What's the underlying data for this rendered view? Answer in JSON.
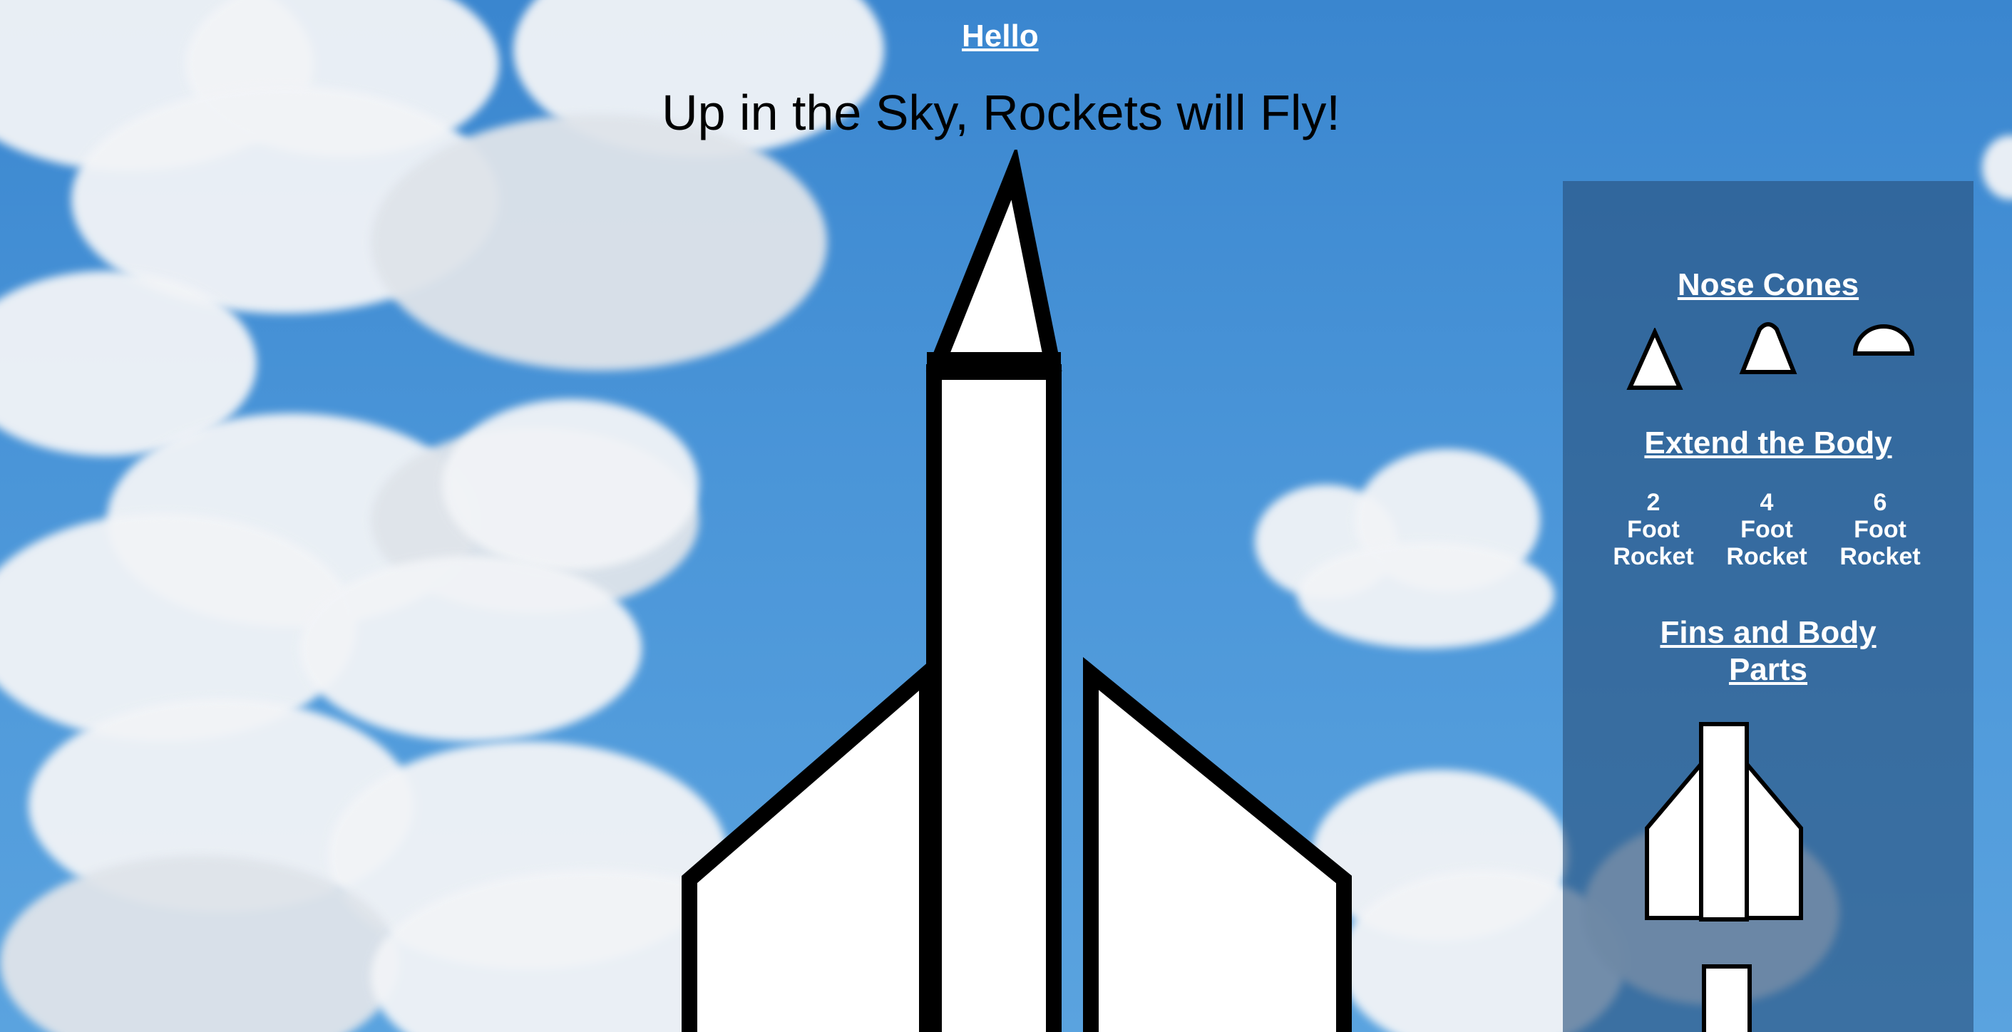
{
  "header": {
    "link_label": "Hello",
    "title": "Up in the Sky, Rockets will Fly!"
  },
  "sidebar": {
    "nose_cones": {
      "heading": "Nose Cones",
      "options": [
        {
          "icon": "pointed-cone-icon"
        },
        {
          "icon": "rounded-tip-cone-icon"
        },
        {
          "icon": "dome-cone-icon"
        }
      ]
    },
    "body": {
      "heading": "Extend the Body",
      "options": [
        {
          "number": "2",
          "unit": "Foot",
          "noun": "Rocket"
        },
        {
          "number": "4",
          "unit": "Foot",
          "noun": "Rocket"
        },
        {
          "number": "6",
          "unit": "Foot",
          "noun": "Rocket"
        }
      ]
    },
    "fins": {
      "heading": "Fins and Body Parts",
      "options": [
        {
          "icon": "fins-body-icon"
        },
        {
          "icon": "body-tube-icon"
        }
      ]
    }
  },
  "colors": {
    "sky": "#4a95d8",
    "panel": "#28507d",
    "outline": "#000000",
    "fill": "#ffffff"
  }
}
